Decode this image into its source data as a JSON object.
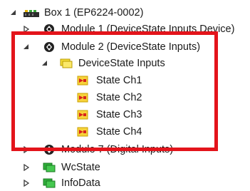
{
  "tree": {
    "box": {
      "label": "Box 1 (EP6224-0002)",
      "icon": "ethercat-box-icon",
      "state": "expanded"
    },
    "module1": {
      "label": "Module 1 (DeviceState Inputs Device)",
      "icon": "module-gear-icon",
      "state": "collapsed"
    },
    "module2": {
      "label": "Module 2 (DeviceState Inputs)",
      "icon": "module-gear-icon",
      "state": "expanded"
    },
    "devicestate_inputs": {
      "label": "DeviceState Inputs",
      "icon": "variable-group-folder-icon",
      "state": "expanded"
    },
    "channels": [
      {
        "label": "State Ch1",
        "icon": "input-variable-icon"
      },
      {
        "label": "State Ch2",
        "icon": "input-variable-icon"
      },
      {
        "label": "State Ch3",
        "icon": "input-variable-icon"
      },
      {
        "label": "State Ch4",
        "icon": "input-variable-icon"
      }
    ],
    "module7": {
      "label": "Module 7 (Digital Inputs)",
      "icon": "module-gear-icon",
      "state": "collapsed"
    },
    "wcstate": {
      "label": "WcState",
      "icon": "green-status-icon",
      "state": "collapsed"
    },
    "infodata": {
      "label": "InfoData",
      "icon": "green-status-icon",
      "state": "collapsed"
    }
  },
  "highlight": {
    "color": "#e3141b"
  }
}
